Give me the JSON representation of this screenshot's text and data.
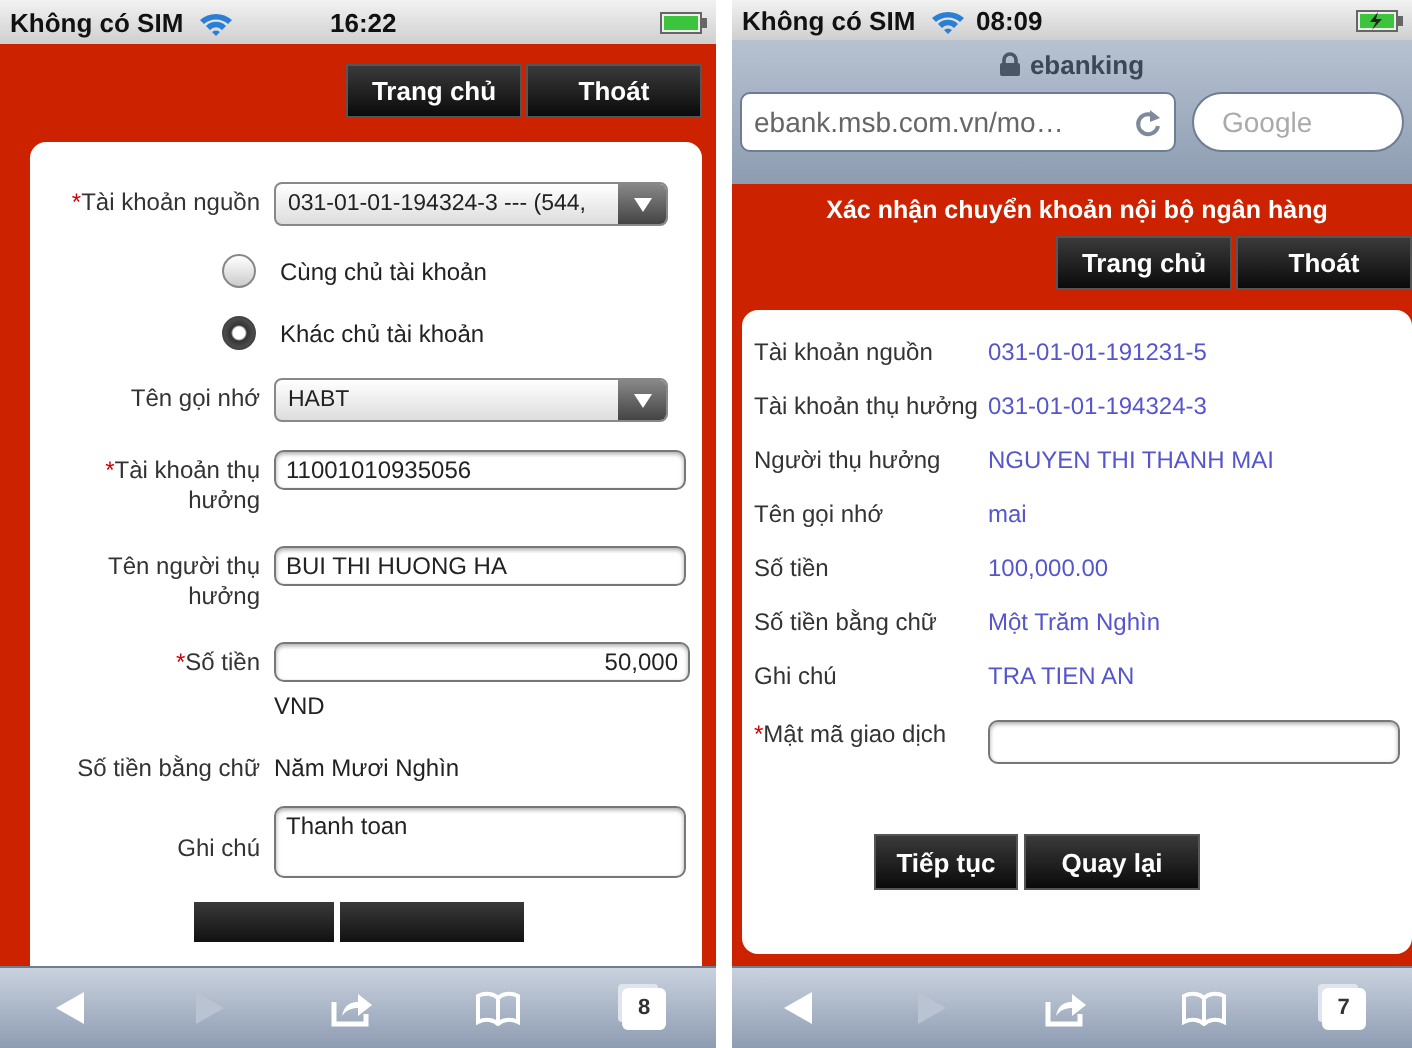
{
  "transfer_screen": {
    "status_bar": {
      "carrier": "Không có SIM",
      "time": "16:22"
    },
    "nav_buttons": [
      "Trang chủ",
      "Thoát"
    ],
    "fields": [
      {
        "kind": "select",
        "required_mark": "*",
        "label": "Tài khoản nguồn",
        "value": "031-01-01-194324-3 --- (544,"
      },
      {
        "kind": "radio",
        "label": "Cùng chủ tài khoản",
        "selected": false
      },
      {
        "kind": "radio",
        "label": "Khác chủ tài khoản",
        "selected": true
      },
      {
        "kind": "select",
        "label": "Tên gọi nhớ",
        "value": "HABT"
      },
      {
        "kind": "input",
        "required_mark": "*",
        "label": "Tài khoản thụ hưởng",
        "value": "11001010935056"
      },
      {
        "kind": "input",
        "label": "Tên người thụ hưởng",
        "value": "BUI THI HUONG HA"
      },
      {
        "kind": "amount",
        "required_mark": "*",
        "label": "Số tiền",
        "value": "50,000",
        "unit": "VND"
      },
      {
        "kind": "text",
        "label": "Số tiền bằng chữ",
        "value": "Năm Mươi Nghìn"
      },
      {
        "kind": "textarea",
        "label": "Ghi chú",
        "value": "Thanh toan"
      }
    ],
    "toolbar": {
      "tab_count": "8"
    }
  },
  "confirm_screen": {
    "status_bar": {
      "carrier": "Không có SIM",
      "time": "08:09"
    },
    "page_title": "ebanking",
    "url": "ebank.msb.com.vn/mo…",
    "search_placeholder": "Google",
    "heading": "Xác nhận chuyển khoản nội bộ ngân hàng",
    "nav_buttons": [
      "Trang chủ",
      "Thoát"
    ],
    "details": [
      {
        "label": "Tài khoản nguồn",
        "value": "031-01-01-191231-5"
      },
      {
        "label": "Tài khoản thụ hưởng",
        "value": "031-01-01-194324-3"
      },
      {
        "label": "Người thụ hưởng",
        "value": "NGUYEN THI THANH MAI"
      },
      {
        "label": "Tên gọi nhớ",
        "value": "mai"
      },
      {
        "label": "Số tiền",
        "value": "100,000.00"
      },
      {
        "label": "Số tiền bằng chữ",
        "value": "Một Trăm Nghìn"
      },
      {
        "label": "Ghi chú",
        "value": "TRA TIEN AN"
      }
    ],
    "password": {
      "required_mark": "*",
      "label": "Mật mã giao dịch"
    },
    "buttons": [
      "Tiếp tục",
      "Quay lại"
    ],
    "toolbar": {
      "tab_count": "7"
    }
  }
}
